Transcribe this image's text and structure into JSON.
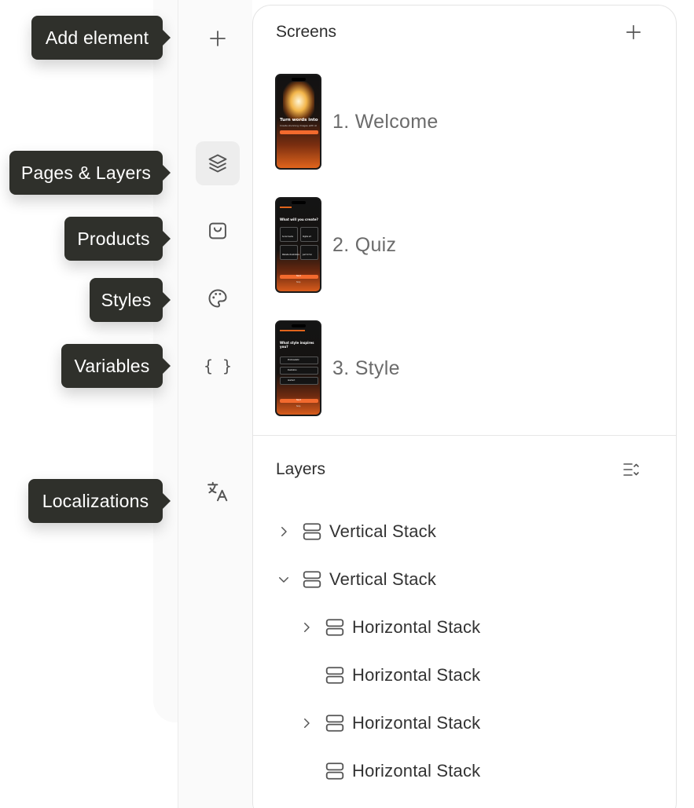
{
  "tooltips": {
    "add_element": "Add element",
    "pages_layers": "Pages & Layers",
    "products": "Products",
    "styles": "Styles",
    "variables": "Variables",
    "localizations": "Localizations"
  },
  "toolbar": {
    "items": [
      {
        "name": "add-element",
        "icon": "plus-icon",
        "active": false
      },
      {
        "name": "pages-layers",
        "icon": "layers-icon",
        "active": true
      },
      {
        "name": "products",
        "icon": "shopping-bag-icon",
        "active": false
      },
      {
        "name": "styles",
        "icon": "palette-icon",
        "active": false
      },
      {
        "name": "variables",
        "icon": "braces-icon",
        "active": false
      },
      {
        "name": "localizations",
        "icon": "translate-icon",
        "active": false
      }
    ],
    "variables_glyph": "{ }"
  },
  "screens": {
    "title": "Screens",
    "items": [
      {
        "label": "1. Welcome",
        "thumb_headline": "Turn words into",
        "thumb_sub": "Create stunning images with AI"
      },
      {
        "label": "2. Quiz",
        "thumb_headline": "What will you create?",
        "thumb_options": [
          "Social media",
          "Digital art",
          "Website illustrations",
          "Just for fun"
        ],
        "thumb_button": "Next",
        "thumb_skip": "Skip"
      },
      {
        "label": "3. Style",
        "thumb_headline": "What style inspires you?",
        "thumb_options": [
          "Photorealistic",
          "Illustration",
          "Abstract"
        ],
        "thumb_button": "Next",
        "thumb_skip": "Skip"
      }
    ]
  },
  "layers": {
    "title": "Layers",
    "items": [
      {
        "label": "Vertical Stack",
        "chevron": "right",
        "depth": 0
      },
      {
        "label": "Vertical Stack",
        "chevron": "down",
        "depth": 0
      },
      {
        "label": "Horizontal Stack",
        "chevron": "right",
        "depth": 1
      },
      {
        "label": "Horizontal Stack",
        "chevron": "none",
        "depth": 1
      },
      {
        "label": "Horizontal Stack",
        "chevron": "right",
        "depth": 1
      },
      {
        "label": "Horizontal Stack",
        "chevron": "none",
        "depth": 1
      }
    ]
  },
  "colors": {
    "tooltip_bg": "#2f302b",
    "accent_orange": "#e0641c"
  }
}
